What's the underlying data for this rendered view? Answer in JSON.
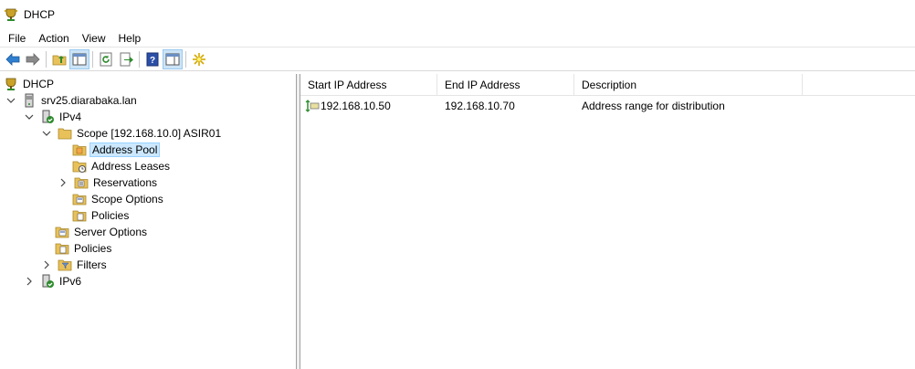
{
  "window": {
    "title": "DHCP"
  },
  "menu": {
    "items": [
      "File",
      "Action",
      "View",
      "Help"
    ]
  },
  "tree": {
    "root": "DHCP",
    "server": "srv25.diarabaka.lan",
    "ipv4": "IPv4",
    "scope": "Scope [192.168.10.0] ASIR01",
    "address_pool": "Address Pool",
    "address_leases": "Address Leases",
    "reservations": "Reservations",
    "scope_options": "Scope Options",
    "scope_policies": "Policies",
    "server_options": "Server Options",
    "policies": "Policies",
    "filters": "Filters",
    "ipv6": "IPv6"
  },
  "list": {
    "columns": [
      "Start IP Address",
      "End IP Address",
      "Description"
    ],
    "rows": [
      {
        "start": "192.168.10.50",
        "end": "192.168.10.70",
        "description": "Address range for distribution"
      }
    ]
  },
  "colors": {
    "selection": "#cce8ff",
    "selection_border": "#99d1ff",
    "folder": "#e8c15a",
    "accent": "#1a73c8"
  }
}
